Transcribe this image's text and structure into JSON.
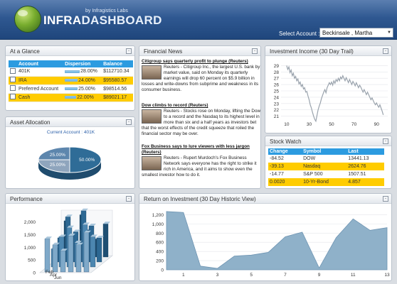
{
  "header": {
    "byline": "by Infragistics Labs",
    "title_a": "INFRA",
    "title_b": "DASHBOARD",
    "select_label": "Select Account :",
    "select_value": "Beckinsale , Martha"
  },
  "glance": {
    "title": "At a Glance",
    "columns": [
      "Account",
      "Dispersion",
      "Balance"
    ],
    "rows": [
      {
        "account": "401K",
        "dispersion": "28.00%",
        "dispersion_value": 28,
        "balance": "$112710.34",
        "highlight": false
      },
      {
        "account": "IRA",
        "dispersion": "24.00%",
        "dispersion_value": 24,
        "balance": "$95580.57",
        "highlight": true
      },
      {
        "account": "Preferred Account",
        "dispersion": "25.00%",
        "dispersion_value": 25,
        "balance": "$98514.56",
        "highlight": false
      },
      {
        "account": "Cash",
        "dispersion": "22.00%",
        "dispersion_value": 22,
        "balance": "$89021.17",
        "highlight": true
      }
    ]
  },
  "allocation": {
    "title": "Asset Allocation",
    "subtitle": "Current Account : 401K",
    "slices": [
      {
        "label": "50.00%",
        "value": 50
      },
      {
        "label": "25.00%",
        "value": 25
      },
      {
        "label": "25.00%",
        "value": 25
      }
    ]
  },
  "news": {
    "title": "Financial News",
    "items": [
      {
        "headline": "Citigroup says quarterly profit to plunge (Reuters)",
        "body": "Reuters - Citigroup Inc., the largest U.S. bank by market value, said on Monday its quarterly earnings will drop 60 percent on $5.9 billion in losses and write-downs from subprime and weakness in its consumer business."
      },
      {
        "headline": "Dow climbs to record (Reuters)",
        "body": "Reuters - Stocks rose on Monday, lifting the Dow to a record and the Nasdaq to its highest level in more than six and a half years as investors bet that the worst effects of the credit squeeze that roiled the financial sector may be over."
      },
      {
        "headline": "Fox Business says to lure viewers with less jargon (Reuters)",
        "body": "Reuters - Rupert Murdoch's Fox Business Network says everyone has the right to strike it rich in America, and it aims to show even the smallest investor how to do it."
      }
    ]
  },
  "income": {
    "title": "Investment Income (30 Day Trail)"
  },
  "stock": {
    "title": "Stock Watch",
    "columns": [
      "Change",
      "Symbol",
      "Last"
    ],
    "rows": [
      {
        "change": "-84.52",
        "symbol": "DOW",
        "last": "13441.13",
        "highlight": false
      },
      {
        "change": "-39.13",
        "symbol": "Nasdaq",
        "last": "2624.76",
        "highlight": true
      },
      {
        "change": "-14.77",
        "symbol": "S&P 500",
        "last": "1507.51",
        "highlight": false
      },
      {
        "change": "0.0020",
        "symbol": "10-Yr-Bond",
        "last": "4.857",
        "highlight": true
      }
    ]
  },
  "performance": {
    "title": "Performance"
  },
  "roi": {
    "title": "Return on Investment  (30 Day Historic View)"
  },
  "colors": {
    "accent": "#2c9be0",
    "highlight": "#ffcc00",
    "line": "#9aa3ad",
    "area": "#8fb1c9"
  },
  "chart_data": [
    {
      "type": "line",
      "title": "Investment Income (30 Day Trail)",
      "x": [
        10,
        11,
        12,
        13,
        14,
        15,
        16,
        17,
        18,
        19,
        20,
        21,
        22,
        23,
        24,
        25,
        26,
        27,
        28,
        29,
        30,
        31,
        32,
        33,
        34,
        35,
        36,
        37,
        38,
        39,
        40,
        41,
        42,
        43,
        44,
        45,
        46,
        47,
        48,
        49,
        50,
        51,
        52,
        53,
        54,
        55,
        56,
        57,
        58,
        59,
        60,
        61,
        62,
        63,
        64,
        65,
        66,
        67,
        68,
        69,
        70,
        71,
        72,
        73,
        74,
        75,
        76,
        77,
        78,
        79,
        80,
        81,
        82,
        83,
        84,
        85,
        86,
        87,
        88,
        89,
        90,
        91,
        92,
        93,
        94,
        95,
        96
      ],
      "y": [
        29,
        28.4,
        28.8,
        27.9,
        28.3,
        27.4,
        27.8,
        27.0,
        27.3,
        26.6,
        26.9,
        26.1,
        26.4,
        25.7,
        26.0,
        25.3,
        25.5,
        24.8,
        24.9,
        24.2,
        23.6,
        22.8,
        22.3,
        21.6,
        21.0,
        20.5,
        20.2,
        21.1,
        22.0,
        22.6,
        23.1,
        23.8,
        24.3,
        24.8,
        25.2,
        24.7,
        25.5,
        25.9,
        26.3,
        26.0,
        26.4,
        25.9,
        26.6,
        26.2,
        26.8,
        26.5,
        27.0,
        26.6,
        27.2,
        26.9,
        27.4,
        27.0,
        26.6,
        27.1,
        26.7,
        26.3,
        26.8,
        26.4,
        26.0,
        26.5,
        26.2,
        25.8,
        26.3,
        25.9,
        25.5,
        25.9,
        25.6,
        25.2,
        24.8,
        25.2,
        24.8,
        24.4,
        24.8,
        24.4,
        24.0,
        23.6,
        23.9,
        23.5,
        23.1,
        22.8,
        23.1,
        22.7,
        22.4,
        22.8,
        22.3,
        21.8,
        21.2
      ],
      "xticks": [
        10,
        30,
        50,
        70,
        90
      ],
      "yticks": [
        21,
        22,
        23,
        24,
        25,
        26,
        27,
        28,
        29
      ],
      "xlim": [
        5,
        100
      ],
      "ylim": [
        20.5,
        29.5
      ]
    },
    {
      "type": "area",
      "title": "Return on Investment  (30 Day Historic View)",
      "x": [
        0,
        1,
        2,
        3,
        4,
        5,
        6,
        7,
        8,
        9,
        10,
        11,
        12,
        13
      ],
      "y": [
        1270,
        1250,
        80,
        30,
        300,
        320,
        380,
        720,
        820,
        40,
        700,
        1110,
        860,
        920
      ],
      "xticks": [
        1,
        3,
        5,
        7,
        9,
        11,
        13
      ],
      "yticks": [
        0,
        200,
        400,
        600,
        800,
        1000,
        1200
      ],
      "ylim": [
        0,
        1300
      ]
    },
    {
      "type": "bar",
      "title": "Performance",
      "categories": [
        "Feb",
        "Apr",
        "Jun"
      ],
      "yticks": [
        0,
        500,
        1000,
        1500,
        2000
      ],
      "ytick_labels": [
        "0",
        "500",
        "1,000",
        "1,500",
        "2,000"
      ],
      "ylim": [
        0,
        2300
      ]
    }
  ]
}
